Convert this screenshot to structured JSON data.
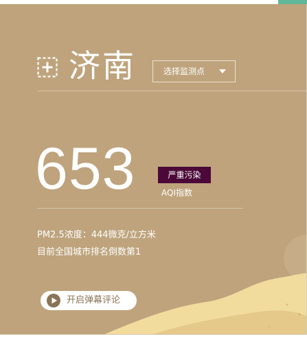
{
  "header": {
    "city": "济南",
    "station_select": {
      "label": "选择监测点",
      "icon": "caret-down-icon"
    },
    "add_city_icon": "plus-square-dashed-icon"
  },
  "aqi": {
    "value": "653",
    "level": "严重污染",
    "caption": "AQI指数"
  },
  "details": {
    "pm25_line": "PM2.5浓度：444微克/立方米",
    "rank_line": "目前全国城市排名倒数第1"
  },
  "danmaku_button": {
    "label": "开启弹幕评论",
    "icon": "play-circle-icon"
  },
  "colors": {
    "panel": "#bea37c",
    "level_badge": "#4b0838",
    "top_accent": "#5fb89a",
    "hill_light": "#f1dc9e",
    "hill_dark": "#e5c98a"
  }
}
